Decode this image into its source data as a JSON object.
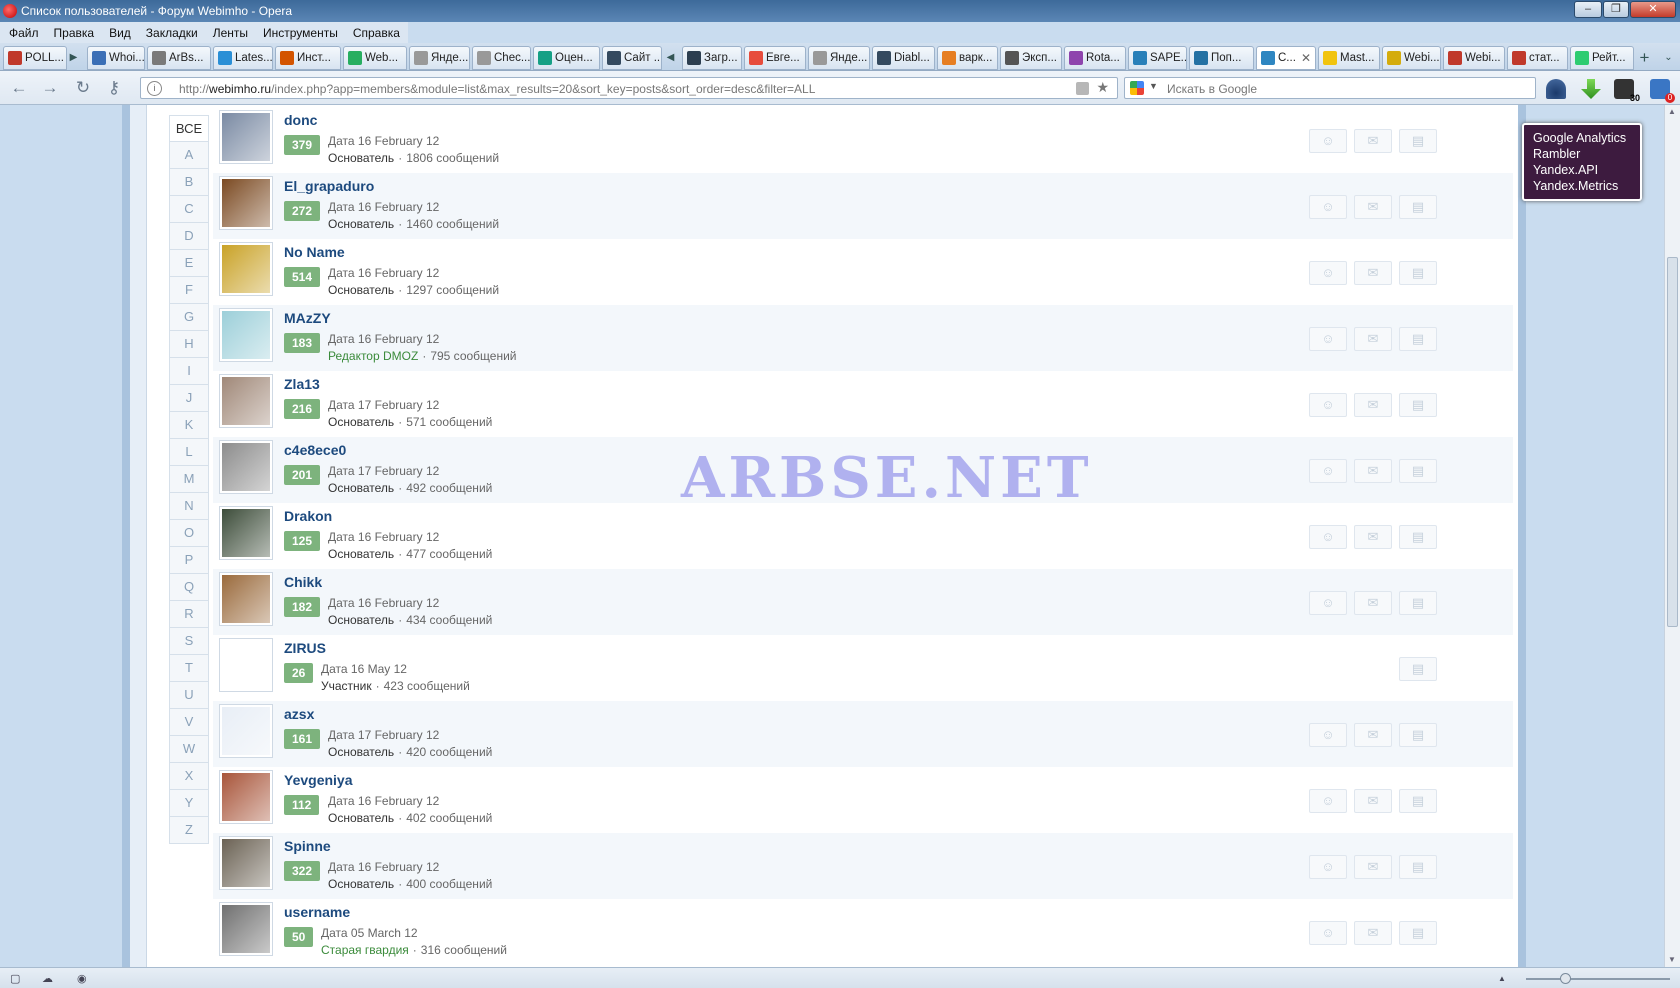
{
  "window": {
    "title": "Список пользователей - Форум Webimho - Opera"
  },
  "menu": [
    "Файл",
    "Правка",
    "Вид",
    "Закладки",
    "Ленты",
    "Инструменты",
    "Справка"
  ],
  "tabs": [
    {
      "label": "POLL...",
      "color": "#c0392b"
    },
    {
      "label": "Whoi...",
      "color": "#3b6fb6"
    },
    {
      "label": "ArBs...",
      "color": "#7a7a7a"
    },
    {
      "label": "Lates...",
      "color": "#2a8fd6"
    },
    {
      "label": "Инст...",
      "color": "#d35400"
    },
    {
      "label": "Web...",
      "color": "#27ae60"
    },
    {
      "label": "Янде...",
      "color": "#999999"
    },
    {
      "label": "Chec...",
      "color": "#999999"
    },
    {
      "label": "Оцен...",
      "color": "#16a085"
    },
    {
      "label": "Сайт ...",
      "color": "#34495e"
    },
    {
      "label": "Загр...",
      "color": "#2c3e50"
    },
    {
      "label": "Евге...",
      "color": "#e74c3c"
    },
    {
      "label": "Янде...",
      "color": "#999999"
    },
    {
      "label": "Diabl...",
      "color": "#34495e"
    },
    {
      "label": "варк...",
      "color": "#e67e22"
    },
    {
      "label": "Эксп...",
      "color": "#555555"
    },
    {
      "label": "Rota...",
      "color": "#8e44ad"
    },
    {
      "label": "SAPE...",
      "color": "#2980b9"
    },
    {
      "label": "Поп...",
      "color": "#2471a3"
    },
    {
      "label": "С...",
      "color": "#2e86c1",
      "active": true
    },
    {
      "label": "Mast...",
      "color": "#f1c40f"
    },
    {
      "label": "Webi...",
      "color": "#d4ac0d"
    },
    {
      "label": "Webi...",
      "color": "#c0392b"
    },
    {
      "label": "стат...",
      "color": "#c0392b"
    },
    {
      "label": "Рейт...",
      "color": "#2ecc71"
    }
  ],
  "address": {
    "host": "webimho.ru",
    "prefix": "http://",
    "path": "/index.php?app=members&module=list&max_results=20&sort_key=posts&sort_order=desc&filter=ALL"
  },
  "search": {
    "placeholder": "Искать в Google"
  },
  "letters": [
    "ВСЕ",
    "A",
    "B",
    "C",
    "D",
    "E",
    "F",
    "G",
    "H",
    "I",
    "J",
    "K",
    "L",
    "M",
    "N",
    "O",
    "P",
    "Q",
    "R",
    "S",
    "T",
    "U",
    "V",
    "W",
    "X",
    "Y",
    "Z"
  ],
  "members": [
    {
      "name": "donc",
      "rep": "379",
      "date": "Дата 16 February 12",
      "group": "Основатель",
      "green": false,
      "posts": "1806 сообщений",
      "avatar": "#7a8aa3",
      "actions": 3
    },
    {
      "name": "El_grapaduro",
      "rep": "272",
      "date": "Дата 16 February 12",
      "group": "Основатель",
      "green": false,
      "posts": "1460 сообщений",
      "avatar": "#7b4a22",
      "actions": 3
    },
    {
      "name": "No Name",
      "rep": "514",
      "date": "Дата 16 February 12",
      "group": "Основатель",
      "green": false,
      "posts": "1297 сообщений",
      "avatar": "#c9a227",
      "actions": 3
    },
    {
      "name": "MAzZY",
      "rep": "183",
      "date": "Дата 16 February 12",
      "group": "Редактор DMOZ",
      "green": true,
      "posts": "795 сообщений",
      "avatar": "#9ccfd9",
      "actions": 3
    },
    {
      "name": "Zla13",
      "rep": "216",
      "date": "Дата 17 February 12",
      "group": "Основатель",
      "green": false,
      "posts": "571 сообщений",
      "avatar": "#a08878",
      "actions": 3
    },
    {
      "name": "c4e8ece0",
      "rep": "201",
      "date": "Дата 17 February 12",
      "group": "Основатель",
      "green": false,
      "posts": "492 сообщений",
      "avatar": "#8c8c8c",
      "actions": 3
    },
    {
      "name": "Drakon",
      "rep": "125",
      "date": "Дата 16 February 12",
      "group": "Основатель",
      "green": false,
      "posts": "477 сообщений",
      "avatar": "#3d4d3a",
      "actions": 3
    },
    {
      "name": "Chikk",
      "rep": "182",
      "date": "Дата 16 February 12",
      "group": "Основатель",
      "green": false,
      "posts": "434 сообщений",
      "avatar": "#9a6a3c",
      "actions": 3
    },
    {
      "name": "ZIRUS",
      "rep": "26",
      "date": "Дата 16 May 12",
      "group": "Участник",
      "green": false,
      "posts": "423 сообщений",
      "avatar": "#ffffff",
      "actions": 1
    },
    {
      "name": "azsx",
      "rep": "161",
      "date": "Дата 17 February 12",
      "group": "Основатель",
      "green": false,
      "posts": "420 сообщений",
      "avatar": "#e8eef6",
      "actions": 3
    },
    {
      "name": "Yevgeniya",
      "rep": "112",
      "date": "Дата 16 February 12",
      "group": "Основатель",
      "green": false,
      "posts": "402 сообщений",
      "avatar": "#a8553a",
      "actions": 3
    },
    {
      "name": "Spinne",
      "rep": "322",
      "date": "Дата 16 February 12",
      "group": "Основатель",
      "green": false,
      "posts": "400 сообщений",
      "avatar": "#6b6254",
      "actions": 3
    },
    {
      "name": "username",
      "rep": "50",
      "date": "Дата 05 March 12",
      "group": "Старая гвардия",
      "green": true,
      "posts": "316 сообщений",
      "avatar": "#707070",
      "actions": 3
    }
  ],
  "separator": "·",
  "watermark": "ARBSE.NET",
  "tooltip": [
    "Google Analytics",
    "Rambler",
    "Yandex.API",
    "Yandex.Metrics"
  ],
  "extensions": {
    "badge1": "30",
    "badge2": "0"
  }
}
